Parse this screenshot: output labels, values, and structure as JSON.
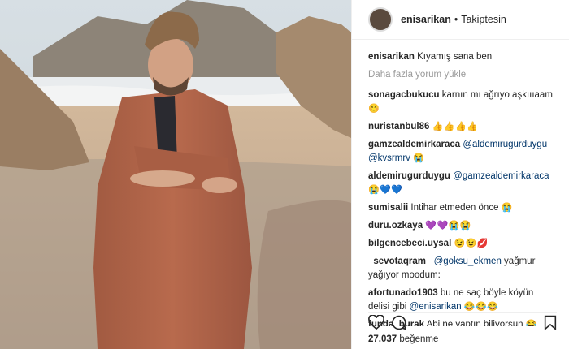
{
  "post": {
    "username": "enisarikan",
    "separator": "•",
    "follow_state": "Takiptesin",
    "caption": "Kıyamış sana ben",
    "load_more": "Daha fazla yorum yükle",
    "likes_count": "27.037",
    "likes_word": "beğenme"
  },
  "comments": [
    {
      "user": "sonagacbukucu",
      "text": "karnın mı ağrıyo aşkıııaam",
      "emoji": "😊"
    },
    {
      "user": "nuristanbul86",
      "text": "",
      "emoji": "👍👍👍👍"
    },
    {
      "user": "gamzealdemirkaraca",
      "mentions": [
        "@aldemirugurduygu",
        "@kvsrmrv"
      ],
      "emoji": "😭"
    },
    {
      "user": "aldemirugurduygu",
      "mentions": [
        "@gamzealdemirkaraca"
      ],
      "emoji": "😭💙💙"
    },
    {
      "user": "sumisalii",
      "text": "Intihar etmeden önce",
      "emoji": "😭"
    },
    {
      "user": "duru.ozkaya",
      "text": "",
      "emoji": "💜💜😭😭"
    },
    {
      "user": "bilgencebeci.uysal",
      "text": "",
      "emoji": "😉😉💋"
    },
    {
      "user": "_sevotaqram_",
      "mention": "@goksu_ekmen",
      "text": "yağmur yağıyor moodum:"
    },
    {
      "user": "afortunado1903",
      "text": "bu ne saç böyle köyün delisi gibi",
      "mention": "@enisarikan",
      "emoji": "😂😂😂"
    },
    {
      "user": "funda_burak",
      "text": "Abi ne yaptın biliyorsun",
      "emoji": "😂"
    }
  ],
  "icons": {
    "like": "heart-icon",
    "comment": "comment-icon",
    "save": "bookmark-icon"
  }
}
